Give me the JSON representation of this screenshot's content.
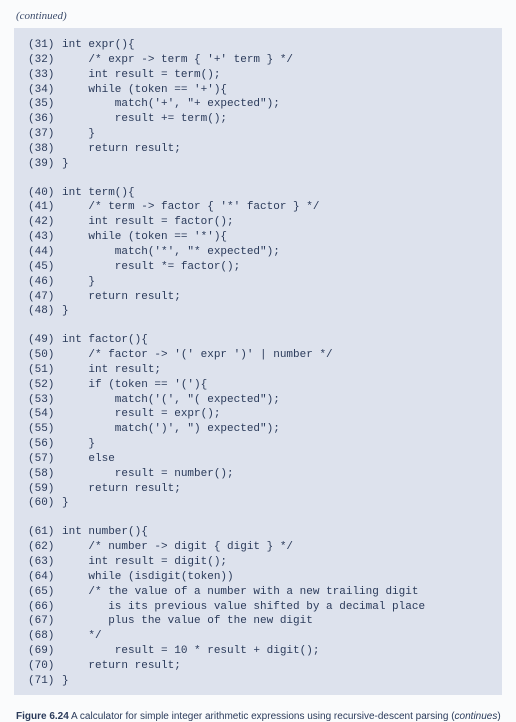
{
  "continued_label": "(continued)",
  "caption": {
    "fig_label": "Figure 6.24",
    "text_before": " A calculator for simple integer arithmetic expressions using recursive-descent parsing (",
    "italic_word": "continues",
    "text_after": ")"
  },
  "code_lines": [
    {
      "n": "(31)",
      "t": "int expr(){",
      "gap": false
    },
    {
      "n": "(32)",
      "t": "    /* expr -> term { '+' term } */",
      "gap": false
    },
    {
      "n": "(33)",
      "t": "    int result = term();",
      "gap": false
    },
    {
      "n": "(34)",
      "t": "    while (token == '+'){",
      "gap": false
    },
    {
      "n": "(35)",
      "t": "        match('+', \"+ expected\");",
      "gap": false
    },
    {
      "n": "(36)",
      "t": "        result += term();",
      "gap": false
    },
    {
      "n": "(37)",
      "t": "    }",
      "gap": false
    },
    {
      "n": "(38)",
      "t": "    return result;",
      "gap": false
    },
    {
      "n": "(39)",
      "t": "}",
      "gap": true
    },
    {
      "n": "(40)",
      "t": "int term(){",
      "gap": false
    },
    {
      "n": "(41)",
      "t": "    /* term -> factor { '*' factor } */",
      "gap": false
    },
    {
      "n": "(42)",
      "t": "    int result = factor();",
      "gap": false
    },
    {
      "n": "(43)",
      "t": "    while (token == '*'){",
      "gap": false
    },
    {
      "n": "(44)",
      "t": "        match('*', \"* expected\");",
      "gap": false
    },
    {
      "n": "(45)",
      "t": "        result *= factor();",
      "gap": false
    },
    {
      "n": "(46)",
      "t": "    }",
      "gap": false
    },
    {
      "n": "(47)",
      "t": "    return result;",
      "gap": false
    },
    {
      "n": "(48)",
      "t": "}",
      "gap": true
    },
    {
      "n": "(49)",
      "t": "int factor(){",
      "gap": false
    },
    {
      "n": "(50)",
      "t": "    /* factor -> '(' expr ')' | number */",
      "gap": false
    },
    {
      "n": "(51)",
      "t": "    int result;",
      "gap": false
    },
    {
      "n": "(52)",
      "t": "    if (token == '('){",
      "gap": false
    },
    {
      "n": "(53)",
      "t": "        match('(', \"( expected\");",
      "gap": false
    },
    {
      "n": "(54)",
      "t": "        result = expr();",
      "gap": false
    },
    {
      "n": "(55)",
      "t": "        match(')', \") expected\");",
      "gap": false
    },
    {
      "n": "(56)",
      "t": "    }",
      "gap": false
    },
    {
      "n": "(57)",
      "t": "    else",
      "gap": false
    },
    {
      "n": "(58)",
      "t": "        result = number();",
      "gap": false
    },
    {
      "n": "(59)",
      "t": "    return result;",
      "gap": false
    },
    {
      "n": "(60)",
      "t": "}",
      "gap": true
    },
    {
      "n": "(61)",
      "t": "int number(){",
      "gap": false
    },
    {
      "n": "(62)",
      "t": "    /* number -> digit { digit } */",
      "gap": false
    },
    {
      "n": "(63)",
      "t": "    int result = digit();",
      "gap": false
    },
    {
      "n": "(64)",
      "t": "    while (isdigit(token))",
      "gap": false
    },
    {
      "n": "(65)",
      "t": "    /* the value of a number with a new trailing digit",
      "gap": false
    },
    {
      "n": "(66)",
      "t": "       is its previous value shifted by a decimal place",
      "gap": false
    },
    {
      "n": "(67)",
      "t": "       plus the value of the new digit",
      "gap": false
    },
    {
      "n": "(68)",
      "t": "    */",
      "gap": false
    },
    {
      "n": "(69)",
      "t": "        result = 10 * result + digit();",
      "gap": false
    },
    {
      "n": "(70)",
      "t": "    return result;",
      "gap": false
    },
    {
      "n": "(71)",
      "t": "}",
      "gap": false
    }
  ]
}
